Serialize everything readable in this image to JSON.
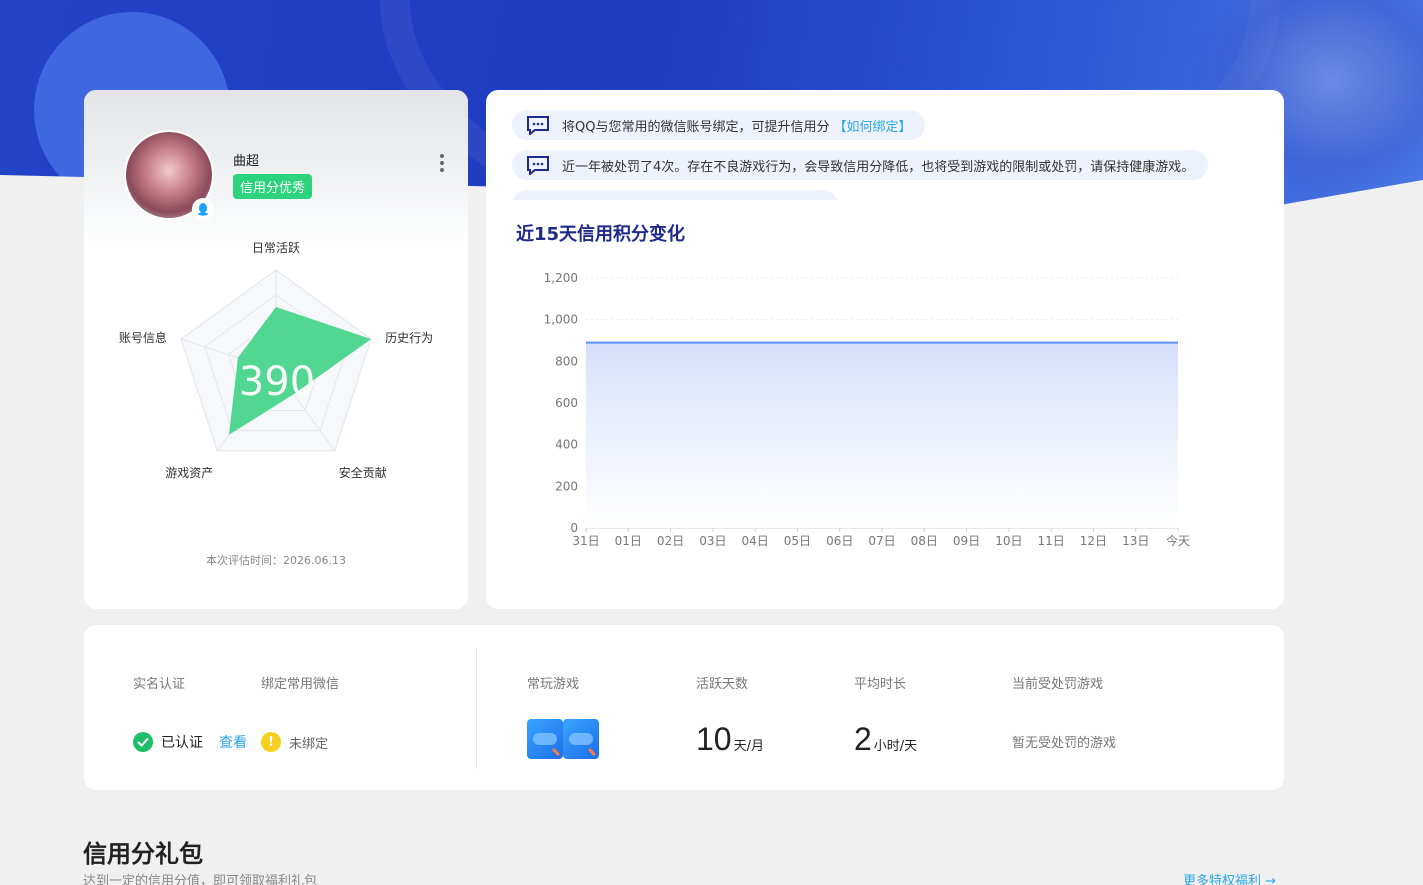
{
  "profile": {
    "nickname": "曲超",
    "credit_badge": "信用分优秀",
    "score": "390",
    "eval_time": "本次评估时间：2026.06.13",
    "radar_axes": [
      "日常活跃",
      "历史行为",
      "安全贡献",
      "游戏资产",
      "账号信息"
    ],
    "radar_values": [
      0.63,
      1.0,
      0.3,
      0.8,
      0.4
    ]
  },
  "notices": [
    {
      "text": "将QQ与您常用的微信账号绑定，可提升信用分",
      "link": "【如何绑定】"
    },
    {
      "text": "近一年被处罚了4次。存在不良游戏行为，会导致信用分降低，也将受到游戏的限制或处罚，请保持健康游戏。",
      "link": ""
    }
  ],
  "chart": {
    "title": "近15天信用积分变化"
  },
  "chart_data": {
    "type": "area",
    "title": "近15天信用积分变化",
    "x": [
      "31日",
      "01日",
      "02日",
      "03日",
      "04日",
      "05日",
      "06日",
      "07日",
      "08日",
      "09日",
      "10日",
      "11日",
      "12日",
      "13日",
      "今天"
    ],
    "series": [
      {
        "values": [
          890,
          890,
          890,
          890,
          890,
          890,
          890,
          890,
          890,
          890,
          890,
          890,
          890,
          890,
          890
        ]
      }
    ],
    "yticks": [
      "0",
      "200",
      "400",
      "600",
      "800",
      "1,000",
      "1,200"
    ],
    "ylim": [
      0,
      1200
    ],
    "grid": true,
    "colors": {
      "line": "#5b8ff9",
      "fill": "#dfe7fc"
    }
  },
  "stats": {
    "real_name_label": "实名认证",
    "wechat_label": "绑定常用微信",
    "verified_text": "已认证",
    "view_link": "查看",
    "unbound_text": "未绑定",
    "games_label": "常玩游戏",
    "active_days_label": "活跃天数",
    "active_days_value": "10",
    "active_days_unit": "天/月",
    "avg_time_label": "平均时长",
    "avg_time_value": "2",
    "avg_time_unit": "小时/天",
    "punish_label": "当前受处罚游戏",
    "punish_value": "暂无受处罚的游戏"
  },
  "gift": {
    "title": "信用分礼包",
    "subtitle": "达到一定的信用分值，即可领取福利礼包",
    "more_link": "更多特权福利 →"
  },
  "colors": {
    "brand_blue": "#2242c8",
    "green": "#2dd27d",
    "link": "#2aa7e8"
  }
}
